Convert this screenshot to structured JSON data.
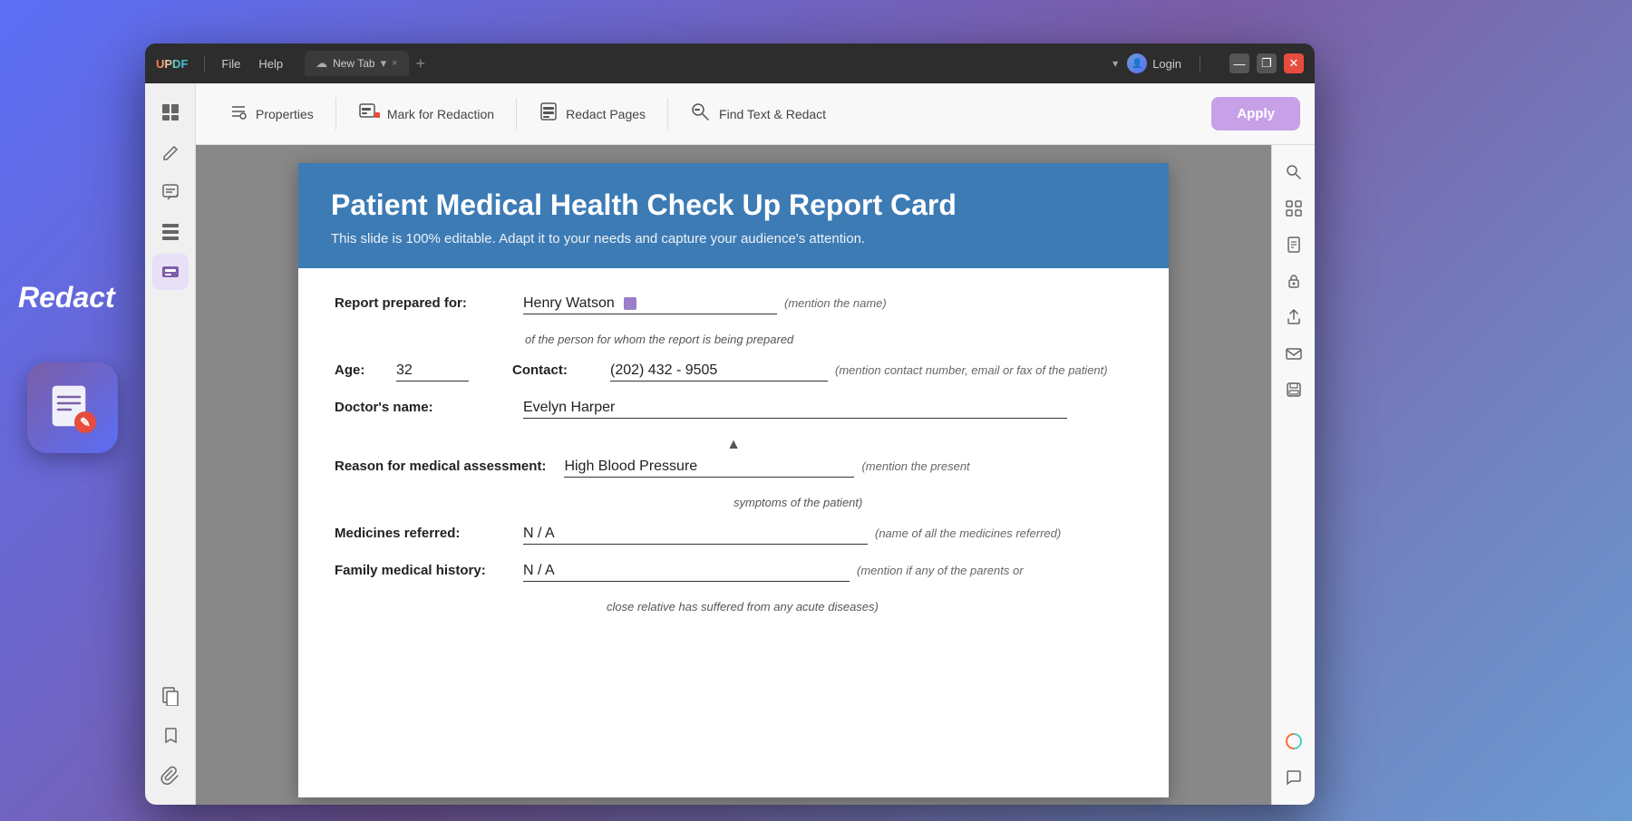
{
  "app": {
    "name": "UPDF",
    "gradient_colors": [
      "#ff6b35",
      "#f7c59f",
      "#4ecdc4",
      "#45b7d1"
    ]
  },
  "titlebar": {
    "file_menu": "File",
    "help_menu": "Help",
    "tab_name": "New Tab",
    "tab_close": "×",
    "tab_add": "+",
    "login_label": "Login",
    "minimize": "—",
    "maximize": "❐",
    "close": "✕"
  },
  "toolbar": {
    "properties_label": "Properties",
    "mark_for_redaction_label": "Mark for Redaction",
    "redact_pages_label": "Redact Pages",
    "find_text_redact_label": "Find Text & Redact",
    "apply_label": "Apply"
  },
  "sidebar": {
    "icons": [
      "☰",
      "✏️",
      "📝",
      "📋",
      "⬛"
    ]
  },
  "right_sidebar": {
    "icons": [
      "🔍",
      "⬛",
      "📄",
      "🔒",
      "📤",
      "✉️",
      "💾",
      "🎨",
      "🔖",
      "📎"
    ]
  },
  "document": {
    "header": {
      "title": "Patient Medical Health Check Up Report Card",
      "subtitle": "This slide is 100% editable. Adapt it to your needs and capture your audience's attention.",
      "bg_color": "#3d7bb5"
    },
    "form": {
      "report_prepared_for_label": "Report prepared for:",
      "report_prepared_for_value": "Henry Watson",
      "report_prepared_for_hint": "(mention the name)",
      "report_subtext": "of the person for whom the report is being prepared",
      "age_label": "Age:",
      "age_value": "32",
      "contact_label": "Contact:",
      "contact_value": "(202) 432 - 9505",
      "contact_hint": "(mention contact number, email or fax of the patient)",
      "doctors_name_label": "Doctor's name:",
      "doctors_name_value": "Evelyn  Harper",
      "reason_label": "Reason for medical assessment:",
      "reason_value": "High Blood Pressure",
      "reason_hint": "(mention the present",
      "reason_subtext": "symptoms of the patient)",
      "medicines_label": "Medicines referred:",
      "medicines_value": "N / A",
      "medicines_hint": "(name of all the medicines referred)",
      "family_history_label": "Family medical history:",
      "family_history_value": "N / A",
      "family_history_hint": "(mention if any of the parents or",
      "family_subtext": "close relative has suffered from any acute diseases)"
    }
  },
  "side_label": {
    "text": "Redact"
  }
}
